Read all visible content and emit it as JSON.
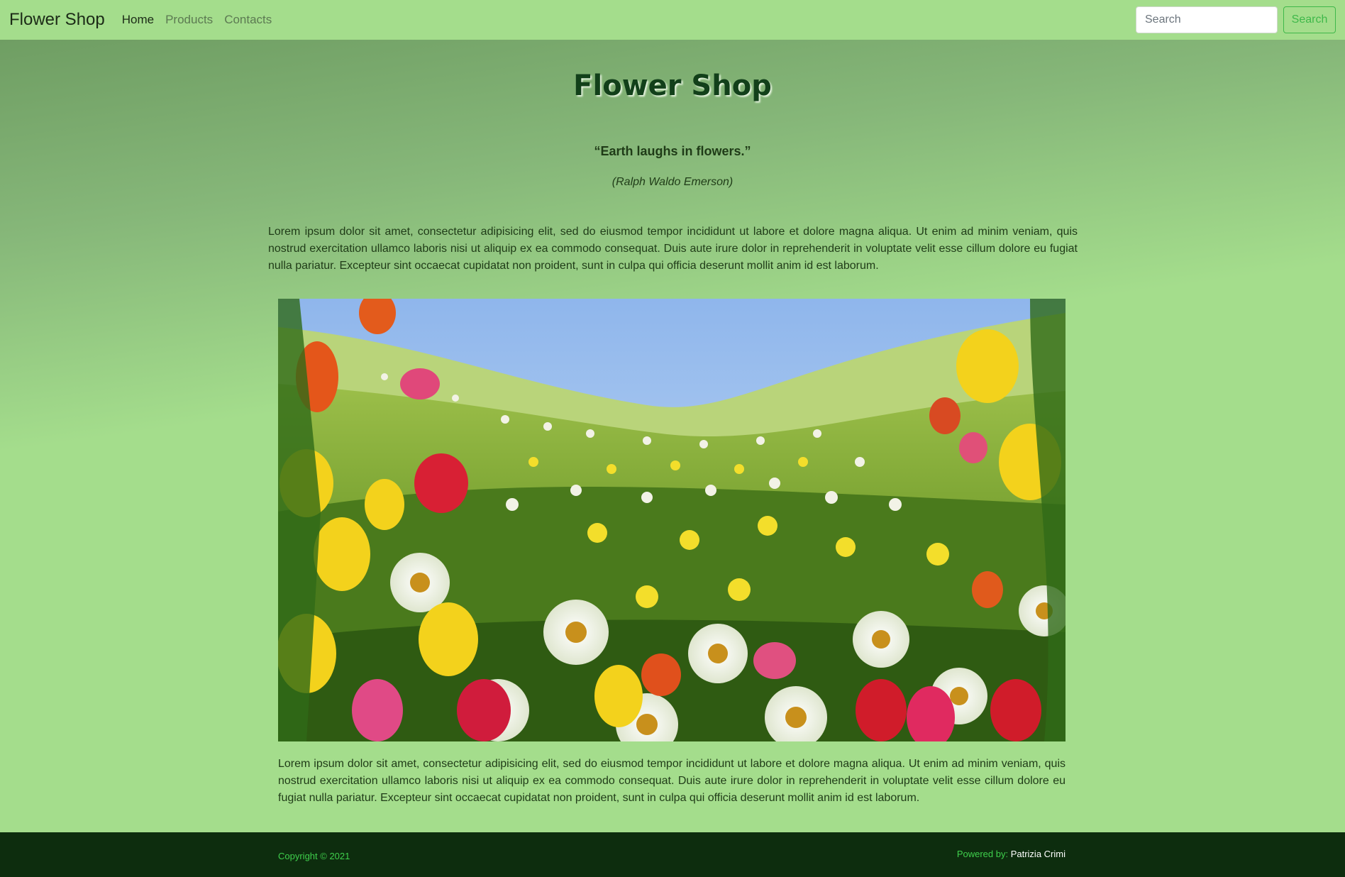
{
  "navbar": {
    "brand": "Flower Shop",
    "links": [
      "Home",
      "Products",
      "Contacts"
    ],
    "search_placeholder": "Search",
    "search_button": "Search"
  },
  "main": {
    "title": "Flower Shop",
    "quote": "“Earth laughs in flowers.”",
    "author": "(Ralph Waldo Emerson)",
    "paragraph1": "Lorem ipsum dolor sit amet, consectetur adipisicing elit, sed do eiusmod tempor incididunt ut labore et dolore magna aliqua. Ut enim ad minim veniam, quis nostrud exercitation ullamco laboris nisi ut aliquip ex ea commodo consequat. Duis aute irure dolor in reprehenderit in voluptate velit esse cillum dolore eu fugiat nulla pariatur. Excepteur sint occaecat cupidatat non proident, sunt in culpa qui officia deserunt mollit anim id est laborum.",
    "paragraph2": "Lorem ipsum dolor sit amet, consectetur adipisicing elit, sed do eiusmod tempor incididunt ut labore et dolore magna aliqua. Ut enim ad minim veniam, quis nostrud exercitation ullamco laboris nisi ut aliquip ex ea commodo consequat. Duis aute irure dolor in reprehenderit in voluptate velit esse cillum dolore eu fugiat nulla pariatur. Excepteur sint occaecat cupidatat non proident, sunt in culpa qui officia deserunt mollit anim id est laborum."
  },
  "footer": {
    "copyright": "Copyright © 2021",
    "powered_label": "Powered by:",
    "powered_name": "Patrizia Crimi"
  },
  "colors": {
    "background": "#a4dd8c",
    "footer": "#0d2d0e",
    "accent": "#3fb84a",
    "title": "#12401a"
  }
}
